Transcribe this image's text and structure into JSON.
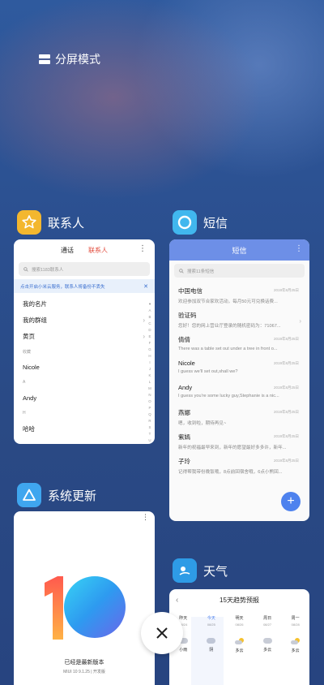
{
  "split_mode": {
    "label": "分屏模式"
  },
  "contacts_app": {
    "name": "联系人",
    "tabs": [
      "通话",
      "联系人"
    ],
    "search_placeholder": "搜索1183联系人",
    "banner": "点击开启小米云服务，联系人将备份不丢失",
    "rows": [
      {
        "label": "我的名片",
        "kind": "row"
      },
      {
        "label": "我的群组",
        "kind": "row"
      },
      {
        "label": "黄页",
        "kind": "row"
      },
      {
        "label": "收藏",
        "kind": "section"
      },
      {
        "label": "Nicole",
        "kind": "row"
      },
      {
        "label": "A",
        "kind": "section"
      },
      {
        "label": "Andy",
        "kind": "row"
      },
      {
        "label": "H",
        "kind": "section"
      },
      {
        "label": "哈哈",
        "kind": "row"
      }
    ],
    "alphabet": [
      "♥",
      "A",
      "B",
      "C",
      "D",
      "E",
      "F",
      "G",
      "H",
      "I",
      "J",
      "K",
      "L",
      "M",
      "N",
      "O",
      "P",
      "Q",
      "R",
      "S",
      "T",
      "U",
      "V",
      "W",
      "X",
      "Y",
      "Z",
      "#"
    ]
  },
  "sms_app": {
    "name": "短信",
    "title": "短信",
    "search_placeholder": "搜索11条短信",
    "messages": [
      {
        "name": "中国电信",
        "time": "2019年8月25日",
        "preview": "欢迎参加双节合家欢活动，每月50元可兑换话费..."
      },
      {
        "name": "验证码",
        "time": "",
        "preview": "您好！您的网上营业厅登录的随机密码为：71067..."
      },
      {
        "name": "倩倩",
        "time": "2019年8月25日",
        "preview": "There was a table set out under a tree in front o..."
      },
      {
        "name": "Nicole",
        "time": "2019年8月25日",
        "preview": "I guess we'll set out,shall we?"
      },
      {
        "name": "Andy",
        "time": "2019年8月25日",
        "preview": "I guess you're some lucky guy,Stephanie is a nic..."
      },
      {
        "name": "燕娜",
        "time": "2019年8月25日",
        "preview": "嗯，收到啦，期待再见~"
      },
      {
        "name": "紫嫣",
        "time": "2019年8月25日",
        "preview": "新年的祝福最早来到，新年的愿望最好多多许，新年..."
      },
      {
        "name": "子玲",
        "time": "2019年8月25日",
        "preview": "记得帮我带份晚饭哦，8点前回宿舍哦，6点小熊回..."
      }
    ]
  },
  "updater_app": {
    "name": "系统更新",
    "status": "已经是最新版本",
    "version": "MIUI 10 9.1.25 | 开发版"
  },
  "weather_app": {
    "name": "天气",
    "title": "15天趋势预报",
    "days": [
      {
        "label": "昨天",
        "date": "08/24"
      },
      {
        "label": "今天",
        "date": "08/25"
      },
      {
        "label": "明天",
        "date": "08/26"
      },
      {
        "label": "周日",
        "date": "08/27"
      },
      {
        "label": "周一",
        "date": "08/28"
      }
    ],
    "conditions": [
      {
        "label": "小雨",
        "icon": "cloud"
      },
      {
        "label": "阴",
        "icon": "cloud"
      },
      {
        "label": "多云",
        "icon": "sun-cloud"
      },
      {
        "label": "多云",
        "icon": "cloud"
      },
      {
        "label": "多云",
        "icon": "sun-cloud"
      }
    ]
  },
  "colors": {
    "accent_red": "#e24a3b",
    "accent_blue": "#4e82ee",
    "contacts_icon": "#f3b72f",
    "sms_icon": "#41b7ee",
    "updater_icon": "#3fa6ef",
    "weather_icon": "#2e9be6"
  }
}
